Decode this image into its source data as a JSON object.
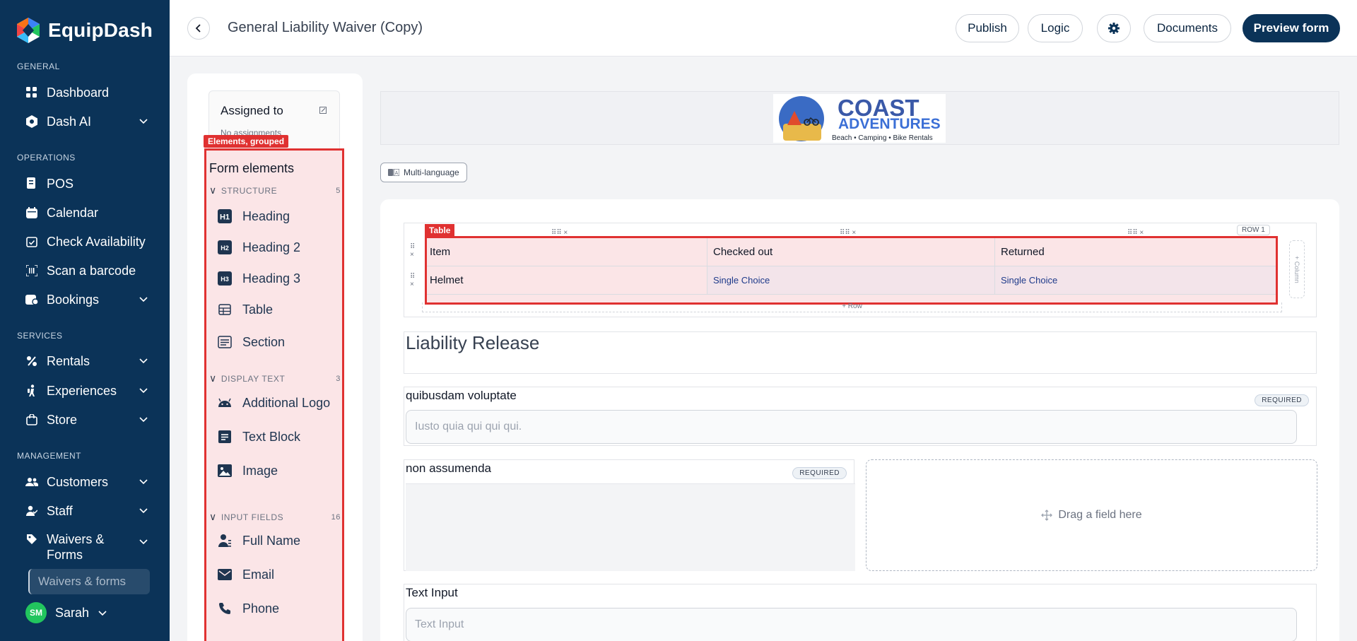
{
  "app": {
    "name": "EquipDash"
  },
  "sidebar": {
    "sections": {
      "general": "GENERAL",
      "operations": "OPERATIONS",
      "services": "SERVICES",
      "management": "MANAGEMENT"
    },
    "items": {
      "dashboard": "Dashboard",
      "dash_ai": "Dash AI",
      "pos": "POS",
      "calendar": "Calendar",
      "check_availability": "Check Availability",
      "scan_barcode": "Scan a barcode",
      "bookings": "Bookings",
      "rentals": "Rentals",
      "experiences": "Experiences",
      "store": "Store",
      "customers": "Customers",
      "staff": "Staff",
      "waivers_forms": "Waivers & Forms"
    },
    "sub_item": "Waivers & forms",
    "user": {
      "initials": "SM",
      "name": "Sarah"
    }
  },
  "topbar": {
    "title": "General Liability Waiver (Copy)",
    "publish": "Publish",
    "logic": "Logic",
    "documents": "Documents",
    "preview": "Preview form"
  },
  "panel": {
    "assigned_title": "Assigned to",
    "assigned_sub": "No assignments",
    "group_tag": "Elements, grouped",
    "title": "Form elements",
    "categories": {
      "structure": {
        "label": "STRUCTURE",
        "count": "5"
      },
      "display_text": {
        "label": "DISPLAY TEXT",
        "count": "3"
      },
      "input_fields": {
        "label": "INPUT FIELDS",
        "count": "16"
      }
    },
    "elements": {
      "heading": "Heading",
      "heading2": "Heading 2",
      "heading3": "Heading 3",
      "table": "Table",
      "section": "Section",
      "additional_logo": "Additional Logo",
      "text_block": "Text Block",
      "image": "Image",
      "full_name": "Full Name",
      "email": "Email",
      "phone": "Phone"
    }
  },
  "logo": {
    "title": "COAST",
    "subtitle": "ADVENTURES",
    "tagline": "Beach • Camping • Bike Rentals"
  },
  "multi_language": "Multi-language",
  "table": {
    "tag": "Table",
    "row_badge": "ROW 1",
    "add_row": "+ Row",
    "add_col": "+ Column",
    "headers": [
      "Item",
      "Checked out",
      "Returned"
    ],
    "rows": [
      [
        "Helmet",
        "Single Choice",
        "Single Choice"
      ]
    ]
  },
  "heading_block": "Liability Release",
  "fields": {
    "f1": {
      "label": "quibusdam voluptate",
      "badge": "REQUIRED",
      "placeholder": "Iusto quia qui qui qui."
    },
    "f2": {
      "label": "non assumenda",
      "badge": "REQUIRED"
    },
    "drop": "Drag a field here",
    "f3": {
      "label": "Text Input",
      "placeholder": "Text Input"
    }
  },
  "colors": {
    "sidebar_bg": "#0b3358",
    "accent_red": "#e03131",
    "primary_dark": "#0b3358"
  }
}
